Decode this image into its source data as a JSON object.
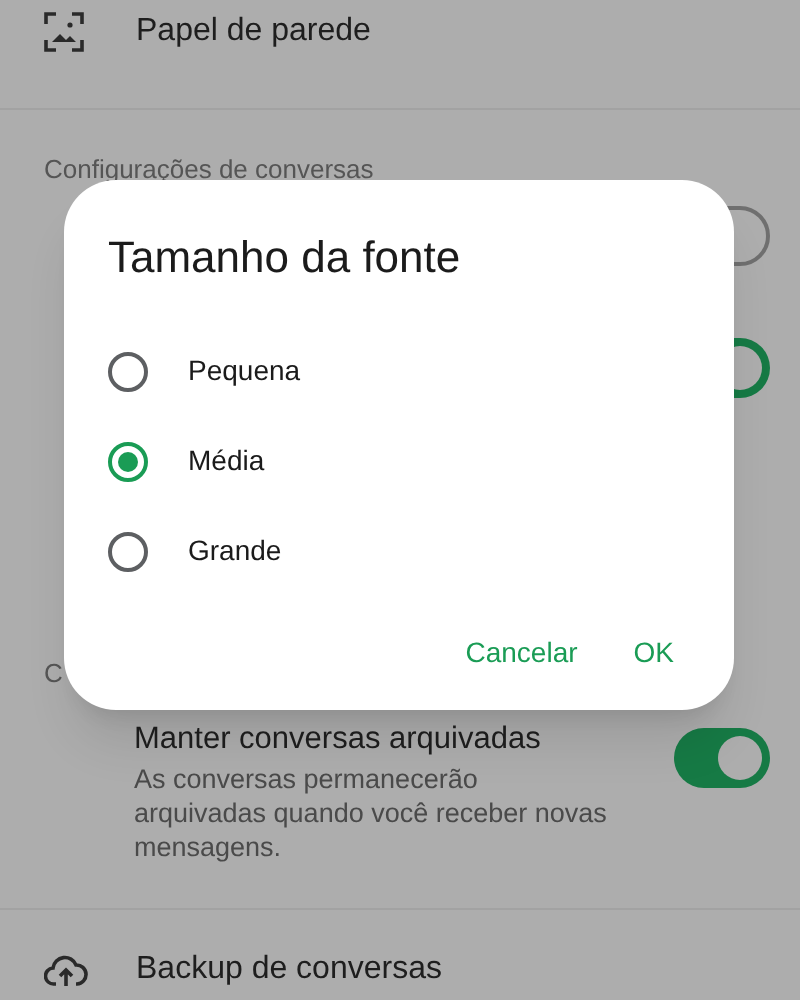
{
  "background": {
    "wallpaper_row": {
      "label": "Papel de parede"
    },
    "section_1": {
      "title": "Configurações de conversas",
      "toggles": [
        {
          "on": false
        },
        {
          "on": true
        }
      ]
    },
    "section_2": {
      "title": "C"
    },
    "archive_row": {
      "label": "Manter conversas arquivadas",
      "description": "As conversas permanecerão arquivadas quando você receber novas mensagens.",
      "on": true
    },
    "backup_row": {
      "label": "Backup de conversas"
    }
  },
  "dialog": {
    "title": "Tamanho da fonte",
    "options": [
      {
        "label": "Pequena",
        "selected": false
      },
      {
        "label": "Média",
        "selected": true
      },
      {
        "label": "Grande",
        "selected": false
      }
    ],
    "buttons": [
      "Cancelar",
      "OK"
    ]
  }
}
